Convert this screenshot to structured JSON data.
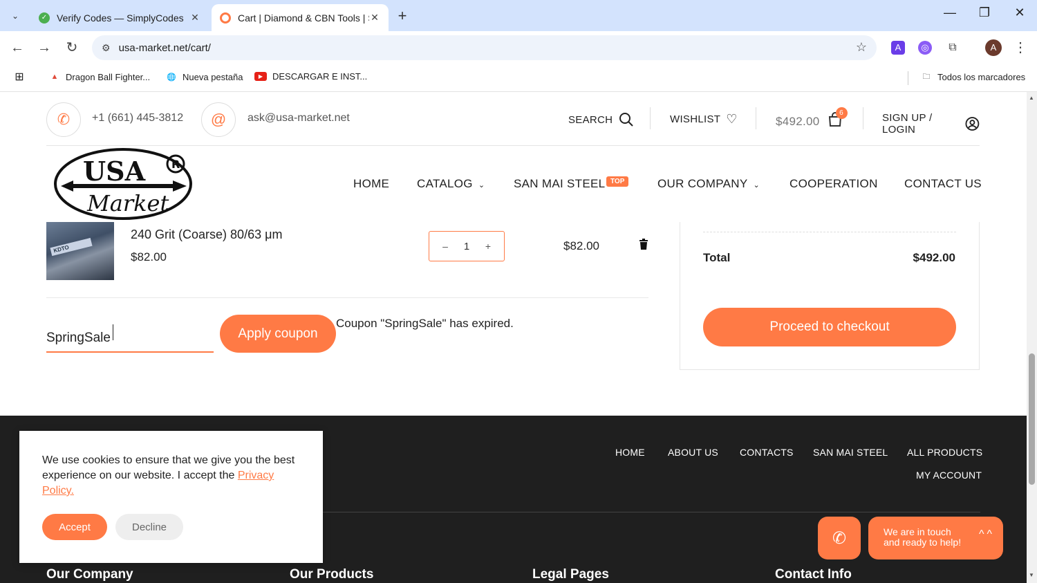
{
  "browser": {
    "tabs": [
      {
        "title": "Verify Codes — SimplyCodes",
        "active": false
      },
      {
        "title": "Cart | Diamond & CBN Tools | S",
        "active": true
      }
    ],
    "url": "usa-market.net/cart/",
    "profile_initial": "A",
    "bookmarks": [
      "Dragon Ball Fighter...",
      "Nueva pestaña",
      "DESCARGAR E INST..."
    ],
    "all_bookmarks_label": "Todos los marcadores"
  },
  "topbar": {
    "phone": "+1 (661) 445-3812",
    "email": "ask@usa-market.net",
    "search_label": "SEARCH",
    "wishlist_label": "WISHLIST",
    "cart_total": "$492.00",
    "cart_count": "6",
    "login_label": "SIGN UP / LOGIN"
  },
  "nav": {
    "items": [
      "HOME",
      "CATALOG",
      "SAN MAI STEEL",
      "OUR COMPANY",
      "COOPERATION",
      "CONTACT US"
    ],
    "top_badge": "TOP"
  },
  "cart_item": {
    "name": "240 Grit (Coarse) 80/63 μm",
    "price": "$82.00",
    "quantity": "1",
    "line_total": "$82.00",
    "thumb_label": "KDTO"
  },
  "coupon": {
    "value": "SpringSale",
    "apply_label": "Apply coupon",
    "message": "Coupon \"SpringSale\" has expired."
  },
  "totals": {
    "total_label": "Total",
    "total_value": "$492.00",
    "checkout_label": "Proceed to checkout"
  },
  "footer": {
    "nav": [
      "HOME",
      "ABOUT US",
      "CONTACTS",
      "SAN MAI STEEL",
      "ALL PRODUCTS",
      "MY ACCOUNT"
    ],
    "headings": [
      "Our Company",
      "Our Products",
      "Legal Pages",
      "Contact Info"
    ]
  },
  "contact_widget": {
    "line1": "We are in touch",
    "line2": "and ready to help!"
  },
  "cookie": {
    "text": "We use cookies to ensure that we give you the best experience on our website. I accept the",
    "link": "Privacy Policy.",
    "accept_label": "Accept",
    "decline_label": "Decline"
  },
  "colors": {
    "accent": "#ff7a45",
    "footer_bg": "#1f1f1f",
    "chrome_tabbar": "#d3e3fd"
  }
}
